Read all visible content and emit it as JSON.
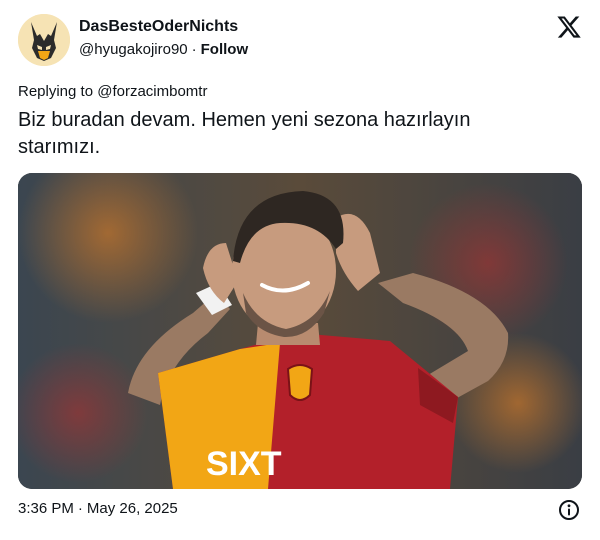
{
  "author": {
    "display_name": "DasBesteOderNichts",
    "handle": "@hyugakojiro90",
    "follow_label": "Follow",
    "avatar_icon": "wolverine-mask-avatar"
  },
  "platform": {
    "logo_icon": "x-logo-icon"
  },
  "reply": {
    "prefix": "Replying to",
    "mention": "@forzacimbomtr"
  },
  "tweet": {
    "text": "Biz buradan devam. Hemen yeni sezona hazırlayın starımızı."
  },
  "media": {
    "jersey_text": "SIXT",
    "colors": {
      "jersey_red": "#b3202a",
      "jersey_yellow": "#f2a615"
    }
  },
  "timestamp": {
    "time": "3:36 PM",
    "separator": "·",
    "date": "May 26, 2025"
  },
  "icons": {
    "info": "info-icon"
  }
}
